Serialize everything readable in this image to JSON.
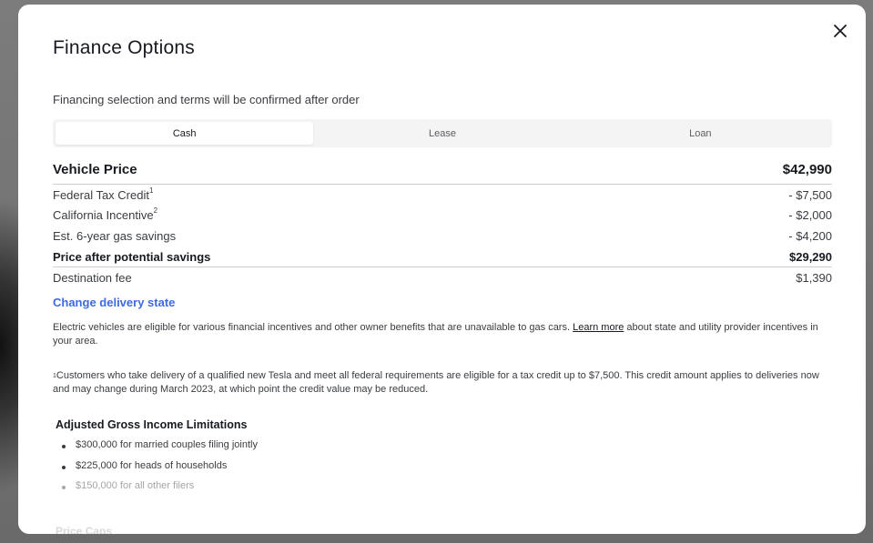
{
  "modal": {
    "title": "Finance Options",
    "subtitle": "Financing selection and terms will be confirmed after order",
    "tabs": [
      {
        "label": "Cash",
        "active": true
      },
      {
        "label": "Lease",
        "active": false
      },
      {
        "label": "Loan",
        "active": false
      }
    ],
    "rows": {
      "vehicle_price": {
        "label": "Vehicle Price",
        "value": "$42,990"
      },
      "federal": {
        "label": "Federal Tax Credit",
        "sup": "1",
        "value": "- $7,500"
      },
      "california": {
        "label": "California Incentive",
        "sup": "2",
        "value": "- $2,000"
      },
      "gas": {
        "label": "Est. 6-year gas savings",
        "value": "- $4,200"
      },
      "after_savings": {
        "label": "Price after potential savings",
        "value": "$29,290"
      },
      "destination": {
        "label": "Destination fee",
        "value": "$1,390"
      }
    },
    "change_state_link": "Change delivery state",
    "incentives_text": {
      "before": "Electric vehicles are eligible for various financial incentives and other owner benefits that are unavailable to gas cars. ",
      "link": "Learn more",
      "after": " about state and utility provider incentives in your area."
    },
    "footnote": {
      "sup": "1",
      "text": "Customers who take delivery of a qualified new Tesla and meet all federal requirements are eligible for a tax credit up to $7,500. This credit amount applies to deliveries now and may change during March 2023, at which point the credit value may be reduced."
    },
    "agi": {
      "title": "Adjusted Gross Income Limitations",
      "items": [
        "$300,000 for married couples filing jointly",
        "$225,000 for heads of households",
        "$150,000 for all other filers"
      ]
    },
    "truncated_heading": "Price Caps"
  },
  "icons": {
    "close": "close-icon"
  },
  "colors": {
    "link": "#3e6ae1",
    "text": "#171a20",
    "muted": "#393c41"
  }
}
